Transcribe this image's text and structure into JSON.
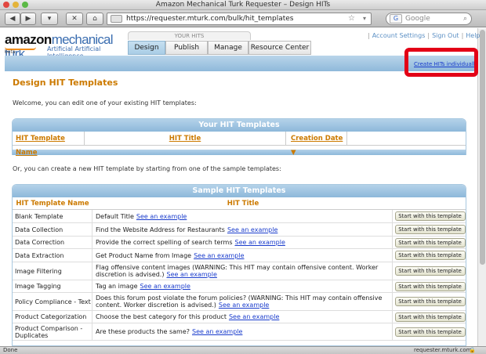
{
  "window": {
    "title": "Amazon Mechanical Turk Requester – Design HITs"
  },
  "browser": {
    "url": "https://requester.mturk.com/bulk/hit_templates",
    "search_placeholder": "Google",
    "status_left": "Done",
    "status_right": "requester.mturk.com"
  },
  "header": {
    "logo_main": "amazon",
    "logo_brand": "mechanical turk",
    "logo_tagline": "Artificial Artificial Intelligence",
    "logo_beta": "beta",
    "group_label": "YOUR HITS",
    "tabs": [
      {
        "label": "Design"
      },
      {
        "label": "Publish"
      },
      {
        "label": "Manage"
      },
      {
        "label": "Resource Center"
      }
    ],
    "links": {
      "account": "Account Settings",
      "signout": "Sign Out",
      "help": "Help"
    },
    "create_link": "Create HITs individually"
  },
  "main": {
    "title": "Design HIT Templates",
    "welcome": "Welcome, you can edit one of your existing HIT templates:",
    "your_templates": {
      "heading": "Your HIT Templates",
      "columns": [
        "HIT Template Name",
        "HIT Title",
        "Creation Date"
      ]
    },
    "or_text": "Or, you can create a new HIT template by starting from one of the sample templates:",
    "sample_templates": {
      "heading": "Sample HIT Templates",
      "columns": [
        "HIT Template Name",
        "HIT Title"
      ],
      "button_label": "Start with this template",
      "example_label": "See an example",
      "rows": [
        {
          "name": "Blank Template",
          "title": "Default Title"
        },
        {
          "name": "Data Collection",
          "title": "Find the Website Address for Restaurants"
        },
        {
          "name": "Data Correction",
          "title": "Provide the correct spelling of search terms"
        },
        {
          "name": "Data Extraction",
          "title": "Get Product Name from Image"
        },
        {
          "name": "Image Filtering",
          "title": "Flag offensive content images (WARNING: This HIT may contain offensive content. Worker discretion is advised.)"
        },
        {
          "name": "Image Tagging",
          "title": "Tag an image"
        },
        {
          "name": "Policy Compliance - Text",
          "title": "Does this forum post violate the forum policies? (WARNING: This HIT may contain offensive content. Worker discretion is advised.)"
        },
        {
          "name": "Product Categorization",
          "title": "Choose the best category for this product"
        },
        {
          "name": "Product Comparison - Duplicates",
          "title": "Are these products the same?"
        }
      ]
    }
  }
}
